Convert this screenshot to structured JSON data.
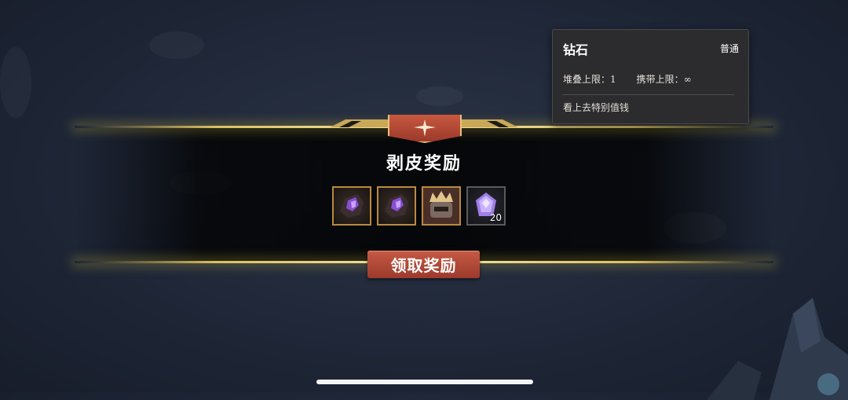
{
  "reward": {
    "title": "剥皮奖励",
    "claim_label": "领取奖励",
    "items": [
      {
        "name": "purple-ore-icon",
        "quantity": ""
      },
      {
        "name": "purple-ore-icon",
        "quantity": ""
      },
      {
        "name": "crown-helmet-icon",
        "quantity": ""
      },
      {
        "name": "diamond-icon",
        "quantity": "20"
      }
    ]
  },
  "tooltip": {
    "name": "钻石",
    "rarity": "普通",
    "stack_limit": "堆叠上限：1",
    "carry_limit": "携带上限：∞",
    "description": "看上去特别值钱"
  },
  "colors": {
    "gold": "#d9bf62",
    "button_red": "#b04a37",
    "background": "#1f2738"
  }
}
